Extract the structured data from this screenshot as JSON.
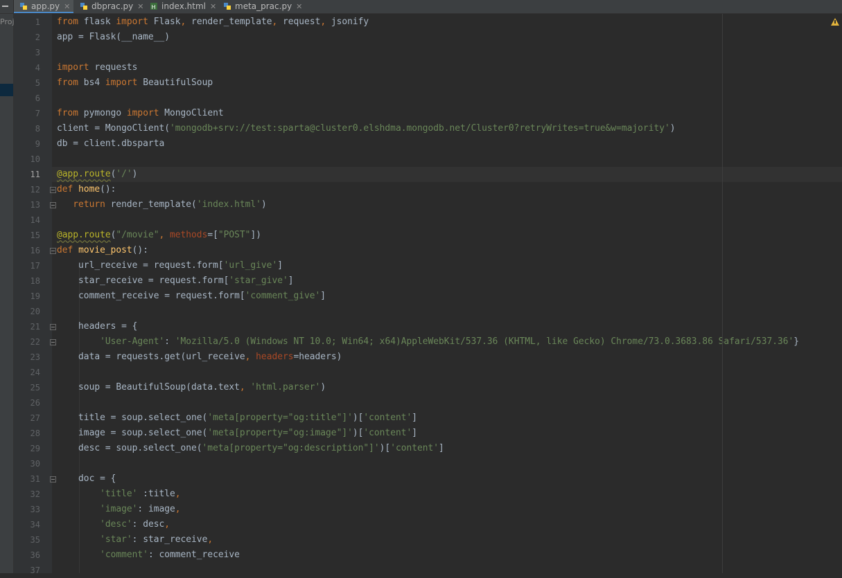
{
  "tabs": [
    {
      "label": "app.py",
      "active": true,
      "icon": "python-file-icon"
    },
    {
      "label": "dbprac.py",
      "active": false,
      "icon": "python-file-icon"
    },
    {
      "label": "index.html",
      "active": false,
      "icon": "html-file-icon"
    },
    {
      "label": "meta_prac.py",
      "active": false,
      "icon": "python-file-icon"
    }
  ],
  "tab_close_glyph": "✕",
  "sidebar": {
    "project_label": "Proj"
  },
  "editor": {
    "current_line": 11,
    "line_numbers": [
      "1",
      "2",
      "3",
      "4",
      "5",
      "6",
      "7",
      "8",
      "9",
      "10",
      "11",
      "12",
      "13",
      "14",
      "15",
      "16",
      "17",
      "18",
      "19",
      "20",
      "21",
      "22",
      "23",
      "24",
      "25",
      "26",
      "27",
      "28",
      "29",
      "30",
      "31",
      "32",
      "33",
      "34",
      "35",
      "36",
      "37"
    ],
    "code_lines": [
      "from flask import Flask, render_template, request, jsonify",
      "app = Flask(__name__)",
      "",
      "import requests",
      "from bs4 import BeautifulSoup",
      "",
      "from pymongo import MongoClient",
      "client = MongoClient('mongodb+srv://test:sparta@cluster0.elshdma.mongodb.net/Cluster0?retryWrites=true&w=majority')",
      "db = client.dbsparta",
      "",
      "@app.route('/')",
      "def home():",
      "   return render_template('index.html')",
      "",
      "@app.route(\"/movie\", methods=[\"POST\"])",
      "def movie_post():",
      "    url_receive = request.form['url_give']",
      "    star_receive = request.form['star_give']",
      "    comment_receive = request.form['comment_give']",
      "",
      "    headers = {",
      "        'User-Agent': 'Mozilla/5.0 (Windows NT 10.0; Win64; x64)AppleWebKit/537.36 (KHTML, like Gecko) Chrome/73.0.3683.86 Safari/537.36'}",
      "    data = requests.get(url_receive, headers=headers)",
      "",
      "    soup = BeautifulSoup(data.text, 'html.parser')",
      "",
      "    title = soup.select_one('meta[property=\"og:title\"]')['content']",
      "    image = soup.select_one('meta[property=\"og:image\"]')['content']",
      "    desc = soup.select_one('meta[property=\"og:description\"]')['content']",
      "",
      "    doc = {",
      "        'title' :title,",
      "        'image': image,",
      "        'desc': desc,",
      "        'star': star_receive,",
      "        'comment': comment_receive",
      ""
    ]
  },
  "inspection": {
    "icon": "warning-icon",
    "color": "#e2b33c"
  },
  "colors": {
    "background": "#2b2b2b",
    "keyword": "#cc7832",
    "string": "#6a8759",
    "function": "#ffc66d",
    "decorator": "#bbb529",
    "named_param": "#aa4926",
    "default_text": "#a9b7c6",
    "line_number": "#606366"
  }
}
